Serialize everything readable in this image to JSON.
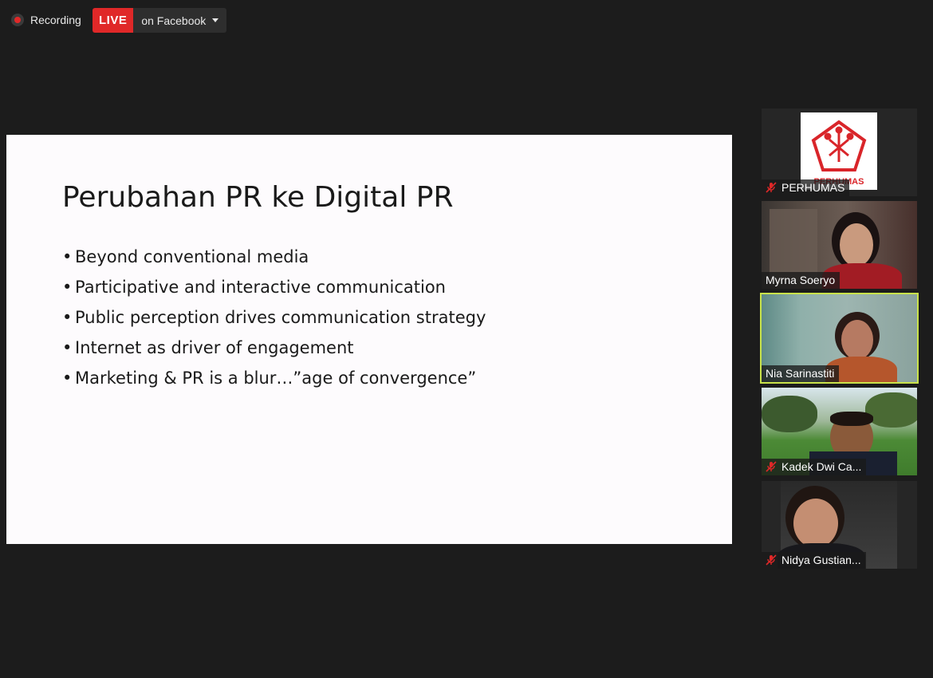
{
  "header": {
    "recording_label": "Recording",
    "live_badge": "LIVE",
    "live_target": "on Facebook"
  },
  "slide": {
    "title": "Perubahan PR ke Digital PR",
    "bullets": [
      "Beyond conventional media",
      "Participative and interactive communication",
      "Public perception drives communication strategy",
      "Internet as driver of engagement",
      "Marketing & PR is a blur…”age of convergence”"
    ]
  },
  "participants": [
    {
      "name": "PERHUMAS",
      "muted": true,
      "logo_text": "PERHUMAS"
    },
    {
      "name": "Myrna Soeryo",
      "muted": false
    },
    {
      "name": "Nia Sarinastiti",
      "muted": false,
      "active_speaker": true
    },
    {
      "name": "Kadek Dwi Ca...",
      "muted": true
    },
    {
      "name": "Nidya Gustian...",
      "muted": true
    }
  ],
  "colors": {
    "background": "#1c1c1c",
    "live_red": "#e02828",
    "active_speaker_border": "#c9e24a",
    "muted_icon": "#e02828"
  }
}
